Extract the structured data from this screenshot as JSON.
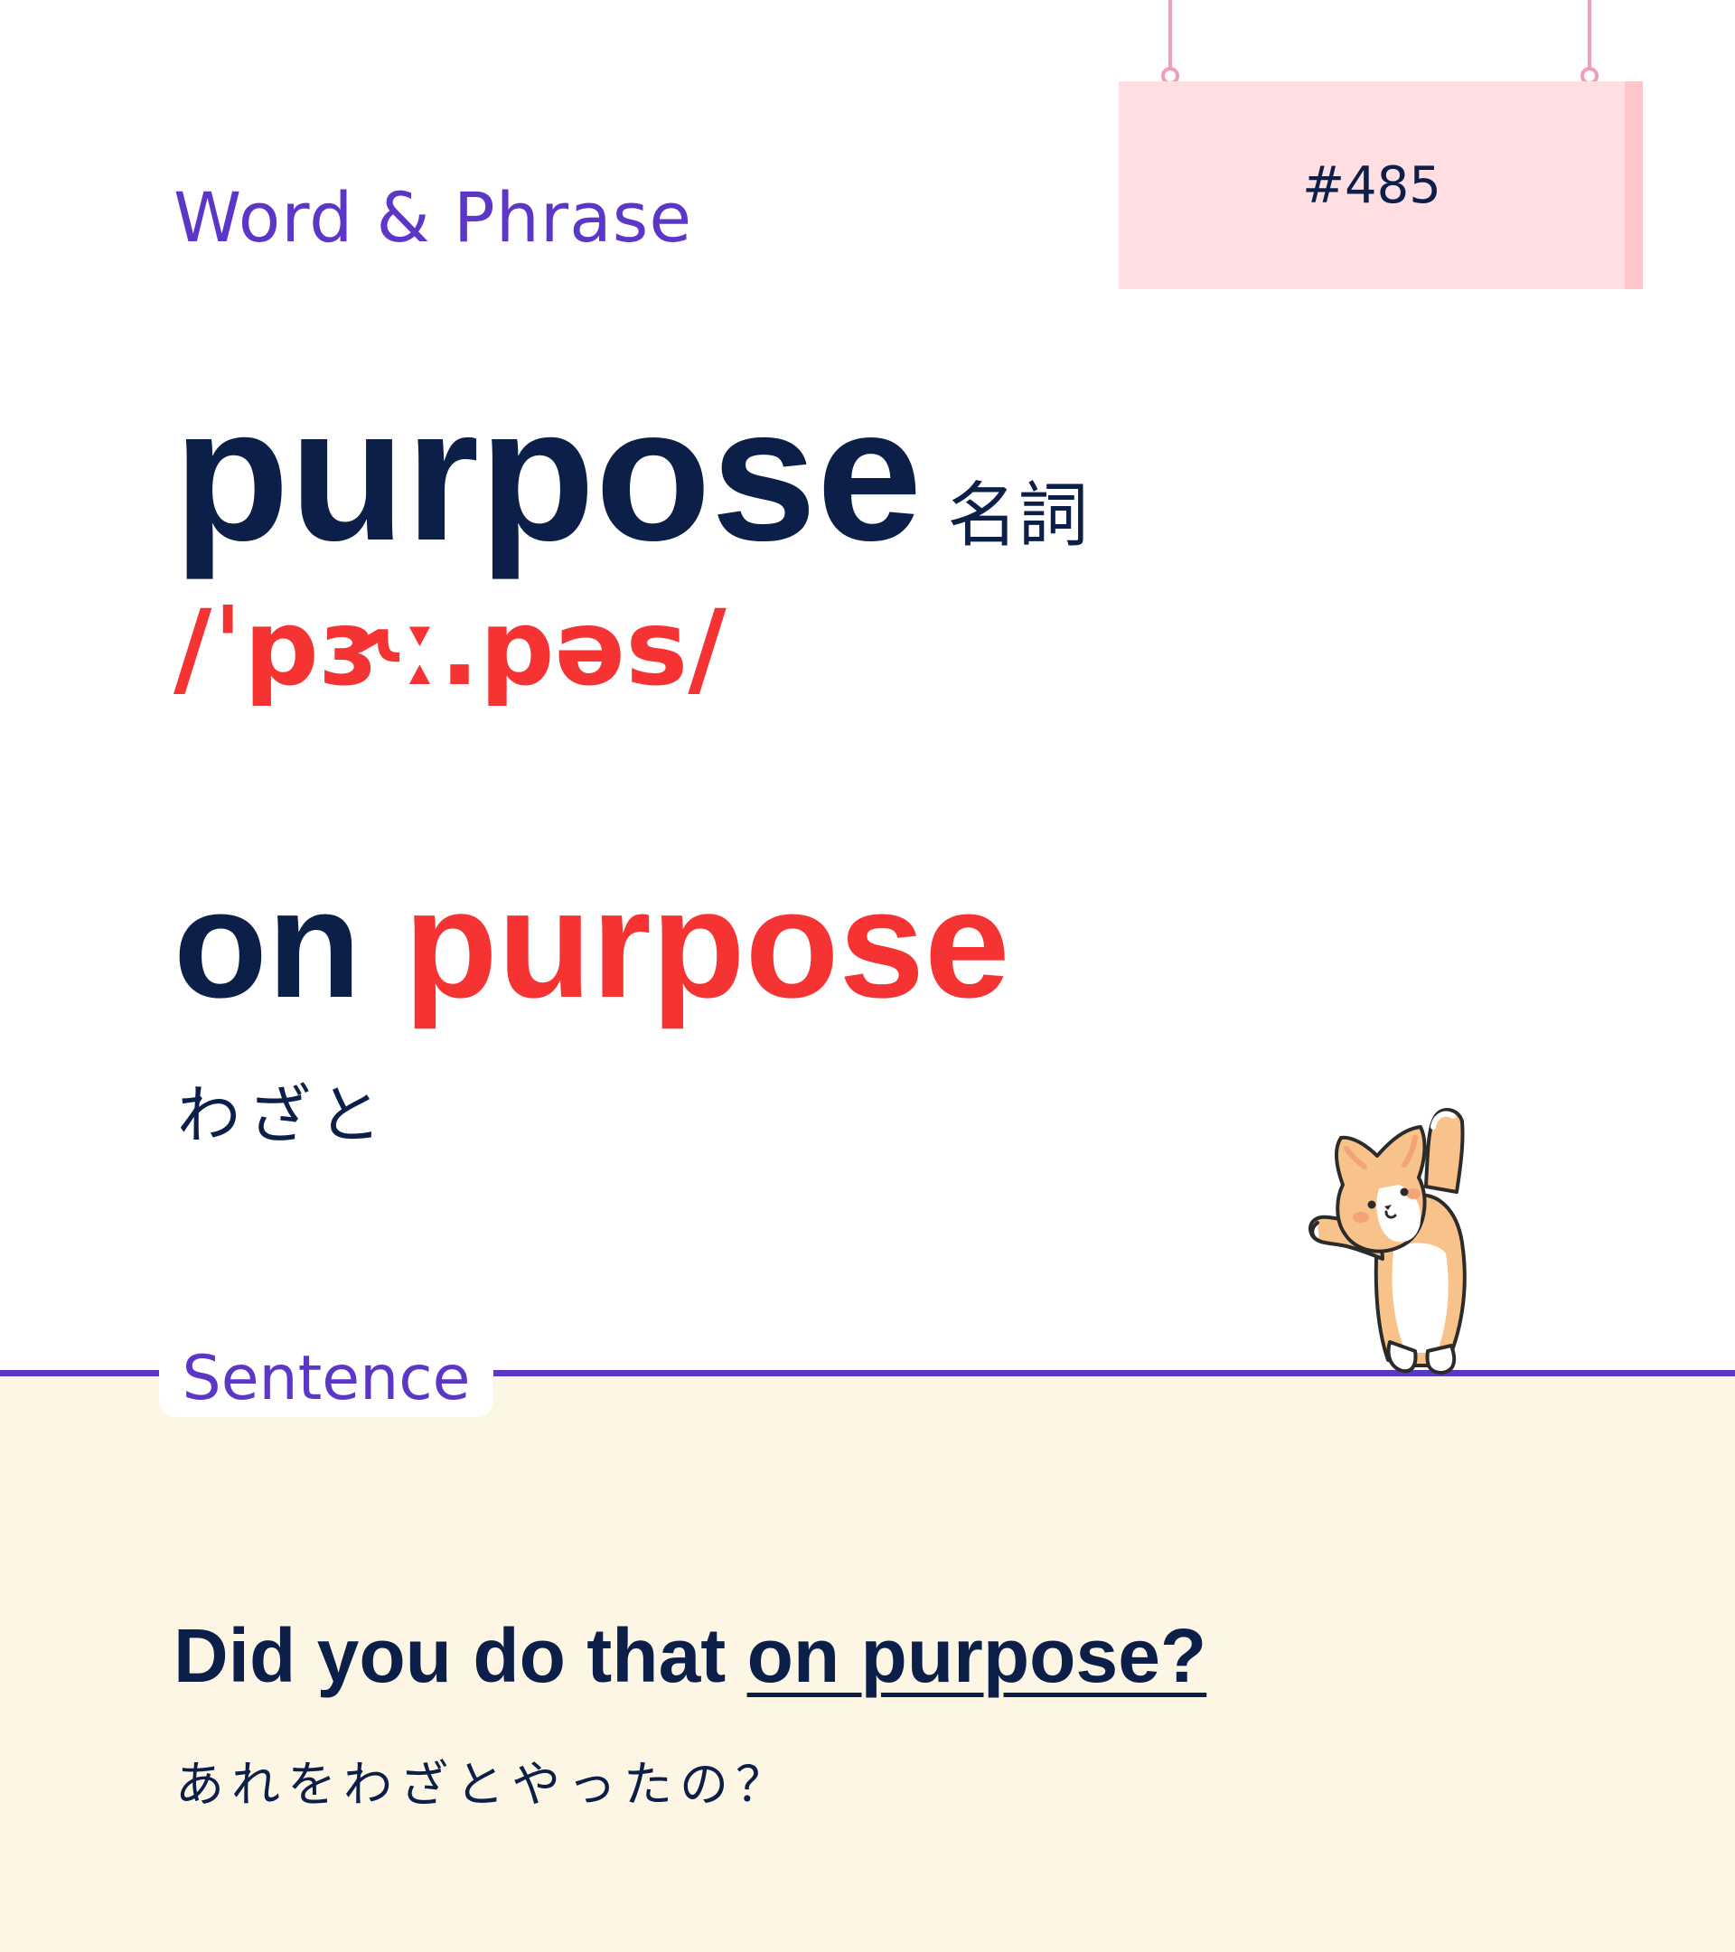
{
  "header": {
    "section_title": "Word & Phrase",
    "card_number": "#485"
  },
  "word": {
    "headword": "purpose",
    "part_of_speech": "名詞",
    "pronunciation": "/ˈpɝː.pəs/"
  },
  "phrase": {
    "prefix": "on ",
    "highlight": "purpose",
    "meaning": "わざと"
  },
  "sentence_section": {
    "label": "Sentence",
    "text_before": "Did you do that ",
    "text_highlight": "on purpose?",
    "translation": "あれをわざとやったの？"
  },
  "colors": {
    "accent_purple": "#5b36c7",
    "accent_red": "#f53333",
    "text_navy": "#0b1f48",
    "sign_pink": "#ffdfe2",
    "bottom_cream": "#fdf6e5"
  },
  "icons": {
    "mascot": "corgi-dog-stretching-icon"
  }
}
